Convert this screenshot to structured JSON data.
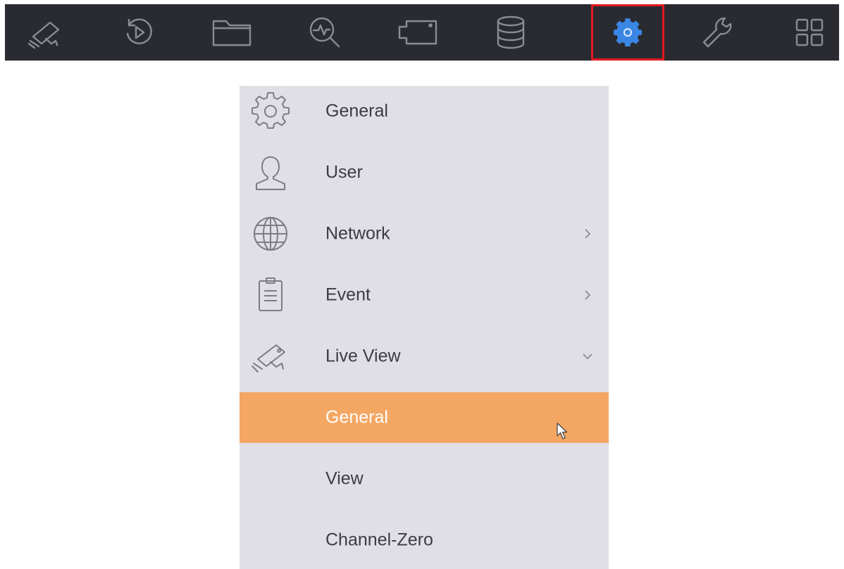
{
  "toolbar": {
    "items": [
      {
        "icon": "camera-icon"
      },
      {
        "icon": "playback-icon"
      },
      {
        "icon": "folder-icon"
      },
      {
        "icon": "search-analytics-icon"
      },
      {
        "icon": "channel-icon"
      },
      {
        "icon": "storage-icon"
      },
      {
        "icon": "gear-icon",
        "active": true
      },
      {
        "icon": "wrench-icon"
      },
      {
        "icon": "grid-icon"
      }
    ],
    "active_outline_color": "#e21a22",
    "active_icon_color": "#3a86e4"
  },
  "menu": {
    "items": [
      {
        "label": "General",
        "icon": "gear-outline-icon"
      },
      {
        "label": "User",
        "icon": "user-icon"
      },
      {
        "label": "Network",
        "icon": "globe-icon",
        "arrow": "chevron-right-icon"
      },
      {
        "label": "Event",
        "icon": "clipboard-icon",
        "arrow": "chevron-right-icon"
      },
      {
        "label": "Live View",
        "icon": "camera-icon",
        "arrow": "chevron-down-icon"
      }
    ],
    "subitems": [
      {
        "label": "General",
        "selected": true
      },
      {
        "label": "View"
      },
      {
        "label": "Channel-Zero"
      }
    ],
    "selected_color": "#f3a763"
  }
}
